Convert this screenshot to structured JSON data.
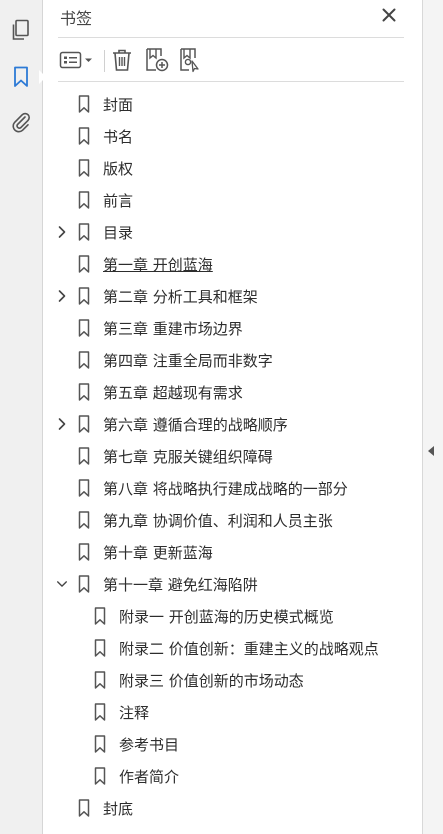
{
  "rail": {
    "items": [
      {
        "name": "pages",
        "icon": "pages-icon"
      },
      {
        "name": "bookmarks",
        "icon": "bookmark-icon",
        "active": true
      },
      {
        "name": "attachments",
        "icon": "paperclip-icon"
      }
    ]
  },
  "panel": {
    "title": "书签",
    "accent": "#2d7ad6"
  },
  "toolbar": {
    "options": "options-icon",
    "delete": "trash-icon",
    "new_bookmark": "new-bookmark-icon",
    "bookmark_from_selection": "bookmark-search-icon"
  },
  "bookmarks": [
    {
      "label": "封面",
      "level": 0,
      "expand": "none"
    },
    {
      "label": "书名",
      "level": 0,
      "expand": "none"
    },
    {
      "label": "版权",
      "level": 0,
      "expand": "none"
    },
    {
      "label": "前言",
      "level": 0,
      "expand": "none"
    },
    {
      "label": "目录",
      "level": 0,
      "expand": "collapsed"
    },
    {
      "label": "第一章  开创蓝海",
      "level": 0,
      "expand": "none",
      "underlined": true
    },
    {
      "label": "第二章  分析工具和框架",
      "level": 0,
      "expand": "collapsed"
    },
    {
      "label": "第三章  重建市场边界",
      "level": 0,
      "expand": "none"
    },
    {
      "label": "第四章  注重全局而非数字",
      "level": 0,
      "expand": "none"
    },
    {
      "label": "第五章  超越现有需求",
      "level": 0,
      "expand": "none"
    },
    {
      "label": "第六章  遵循合理的战略顺序",
      "level": 0,
      "expand": "collapsed"
    },
    {
      "label": "第七章  克服关键组织障碍",
      "level": 0,
      "expand": "none"
    },
    {
      "label": "第八章  将战略执行建成战略的一部分",
      "level": 0,
      "expand": "none"
    },
    {
      "label": "第九章  协调价值、利润和人员主张",
      "level": 0,
      "expand": "none"
    },
    {
      "label": "第十章  更新蓝海",
      "level": 0,
      "expand": "none"
    },
    {
      "label": "第十一章  避免红海陷阱",
      "level": 0,
      "expand": "expanded"
    },
    {
      "label": "附录一  开创蓝海的历史模式概览",
      "level": 1,
      "expand": "none"
    },
    {
      "label": "附录二  价值创新：重建主义的战略观点",
      "level": 1,
      "expand": "none"
    },
    {
      "label": "附录三  价值创新的市场动态",
      "level": 1,
      "expand": "none"
    },
    {
      "label": "注释",
      "level": 1,
      "expand": "none"
    },
    {
      "label": "参考书目",
      "level": 1,
      "expand": "none"
    },
    {
      "label": "作者简介",
      "level": 1,
      "expand": "none"
    },
    {
      "label": "封底",
      "level": 0,
      "expand": "none"
    }
  ]
}
